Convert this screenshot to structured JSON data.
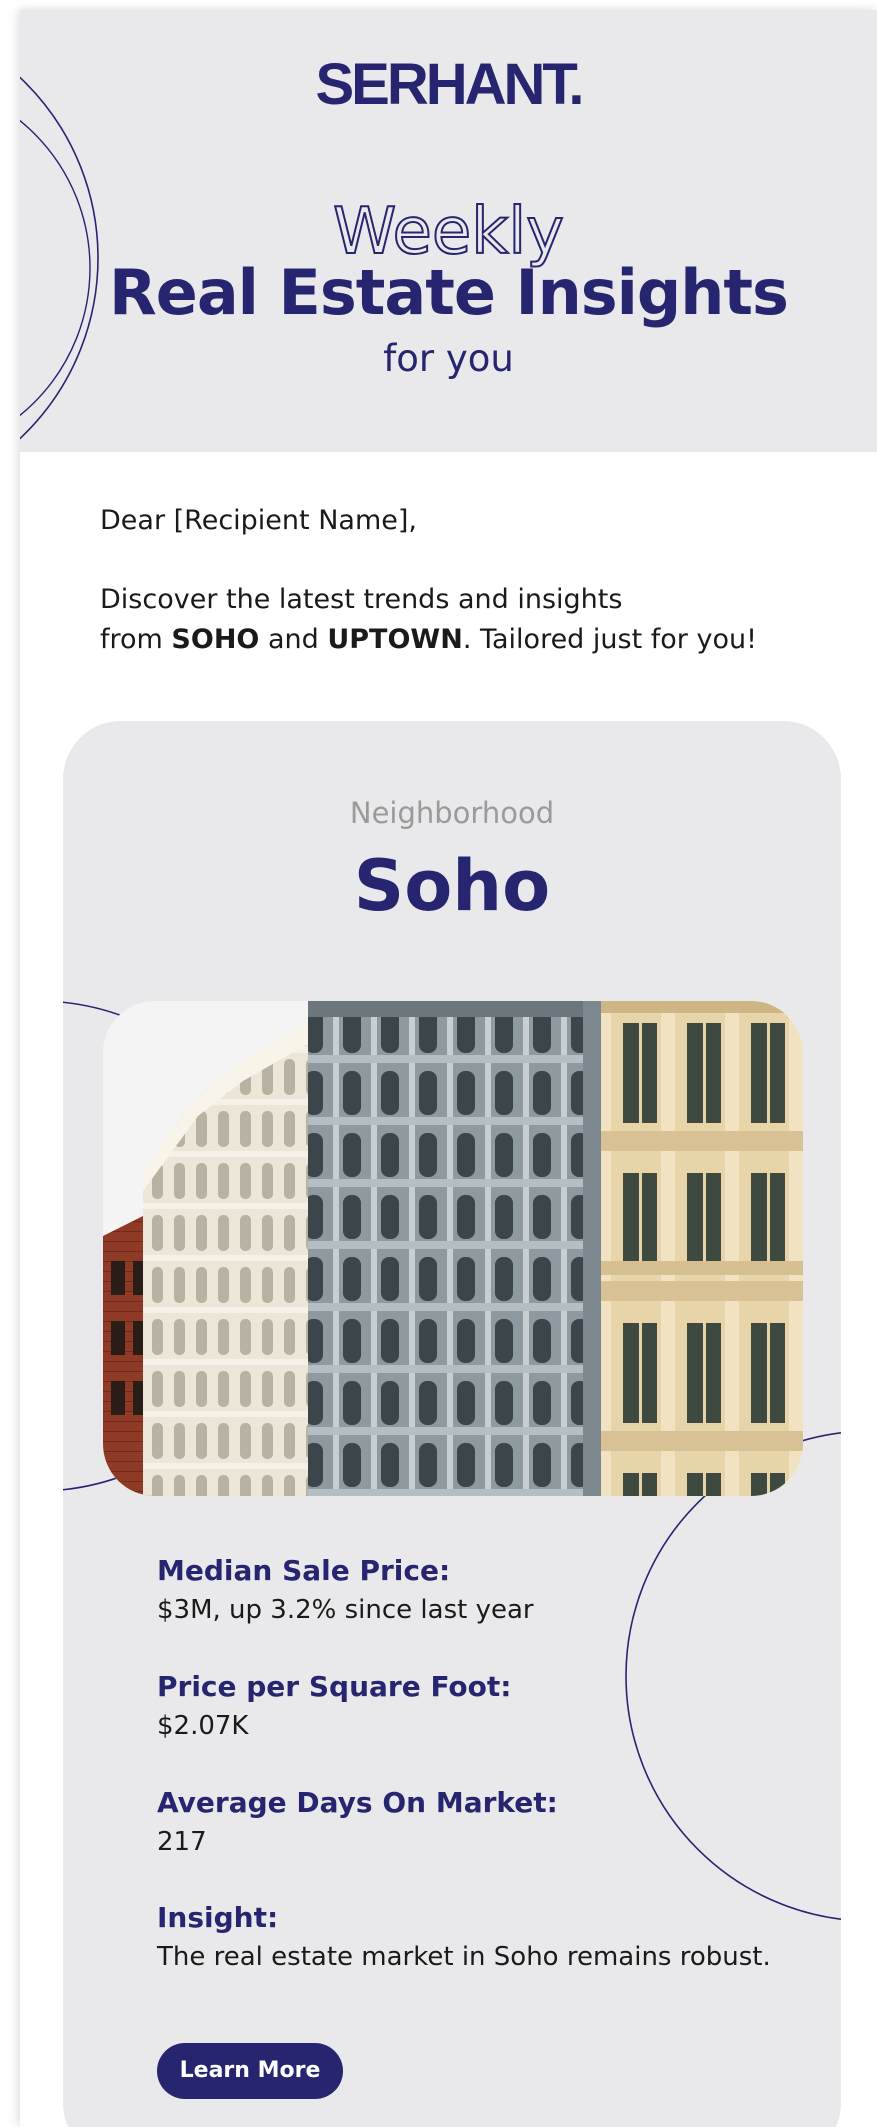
{
  "brand": {
    "logo_text": "SERHANT.",
    "primary_color": "#27256f",
    "panel_color": "#e9e9eb"
  },
  "header": {
    "weekly": "Weekly",
    "headline": "Real Estate Insights",
    "subline": "for you"
  },
  "letter": {
    "greeting": "Dear [Recipient Name],",
    "intro_line1": "Discover the latest trends and insights",
    "intro_from": "from ",
    "intro_hood1": "SOHO",
    "intro_and": " and ",
    "intro_hood2": "UPTOWN",
    "intro_end": ". Tailored just for you!"
  },
  "card": {
    "eyebrow": "Neighborhood",
    "title": "Soho",
    "photo_icon": "cast-iron-building-facades-photo",
    "stats": [
      {
        "label": "Median Sale Price:",
        "value": "$3M, up 3.2% since last year"
      },
      {
        "label": "Price per Square Foot:",
        "value": "$2.07K"
      },
      {
        "label": "Average Days On Market:",
        "value": "217"
      },
      {
        "label": "Insight:",
        "value": "The real estate market in Soho remains robust."
      }
    ],
    "cta_label": "Learn More"
  }
}
